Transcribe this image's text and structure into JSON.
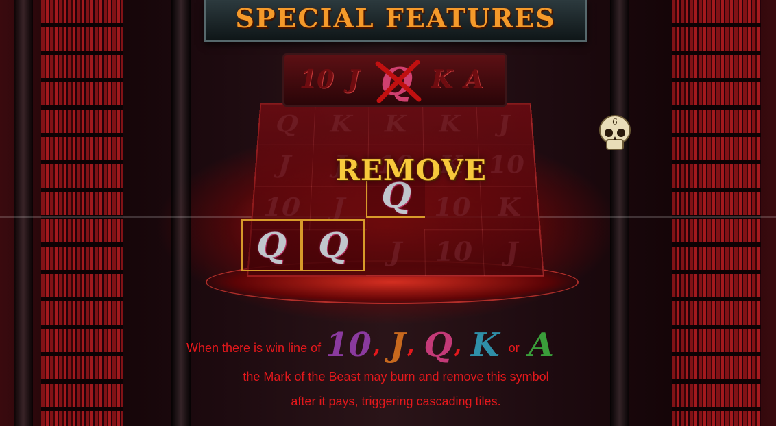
{
  "title": "SPECIAL FEATURES",
  "feature_label": "REMOVE",
  "symbol_bar": [
    "10",
    "J",
    "Q",
    "K",
    "A"
  ],
  "removed_symbol": "Q",
  "grid": [
    [
      "Q",
      "K",
      "K",
      "K",
      "J"
    ],
    [
      "J",
      "J",
      "10",
      "K",
      "10"
    ],
    [
      "10",
      "J",
      "Q",
      "10",
      "K"
    ],
    [
      "Q",
      "Q",
      "J",
      "10",
      "J"
    ]
  ],
  "highlighted_symbol": "Q",
  "description": {
    "line1_prefix": "When there is win line of",
    "symbols": [
      {
        "label": "10",
        "color": "#8a3a9e"
      },
      {
        "label": "J",
        "color": "#c8691e"
      },
      {
        "label": "Q",
        "color": "#c43a78"
      },
      {
        "label": "K",
        "color": "#2f8fa8"
      },
      {
        "label": "A",
        "color": "#3a9e3a"
      }
    ],
    "separator": ",",
    "or_word": "or",
    "line2": "the Mark of the Beast may burn and remove this symbol",
    "line3": "after it pays, triggering cascading tiles."
  },
  "skull_label": "6",
  "colors": {
    "title": "#f59a2a",
    "remove": "#f7c93c",
    "text": "#e4181c",
    "highlight_border": "#d79a2a"
  }
}
